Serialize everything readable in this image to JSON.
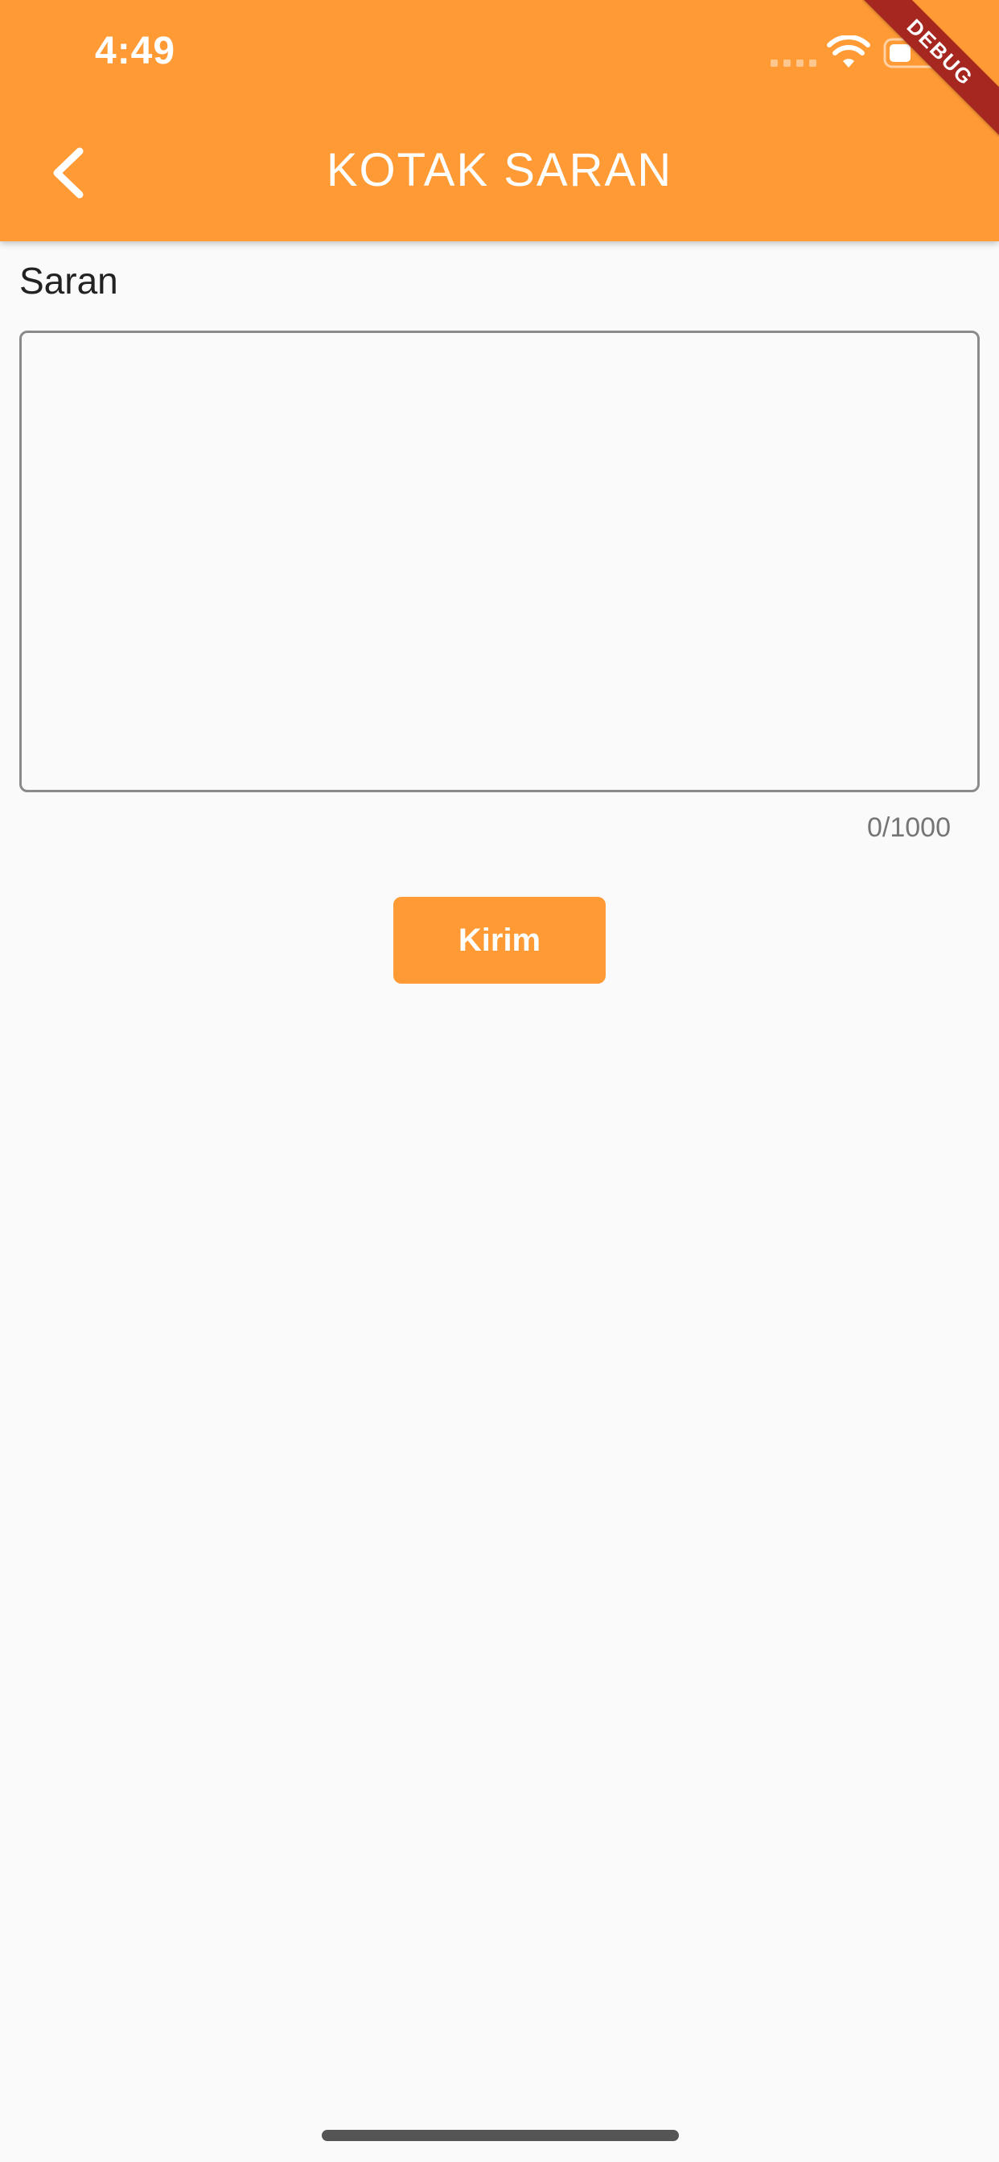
{
  "status_bar": {
    "time": "4:49",
    "icons": [
      "signal-icon",
      "wifi-icon",
      "battery-icon"
    ]
  },
  "app_bar": {
    "title": "KOTAK SARAN",
    "back_icon": "chevron-left-icon",
    "background_color": "#ff9a35"
  },
  "debug_banner": {
    "label": "DEBUG",
    "color": "#a5271f"
  },
  "form": {
    "field_label": "Saran",
    "textarea_value": "",
    "char_counter": "0/1000",
    "submit_label": "Kirim"
  },
  "colors": {
    "accent": "#ff9a35",
    "page_background": "#fafafa",
    "text": "#222222",
    "muted_text": "#757575"
  }
}
